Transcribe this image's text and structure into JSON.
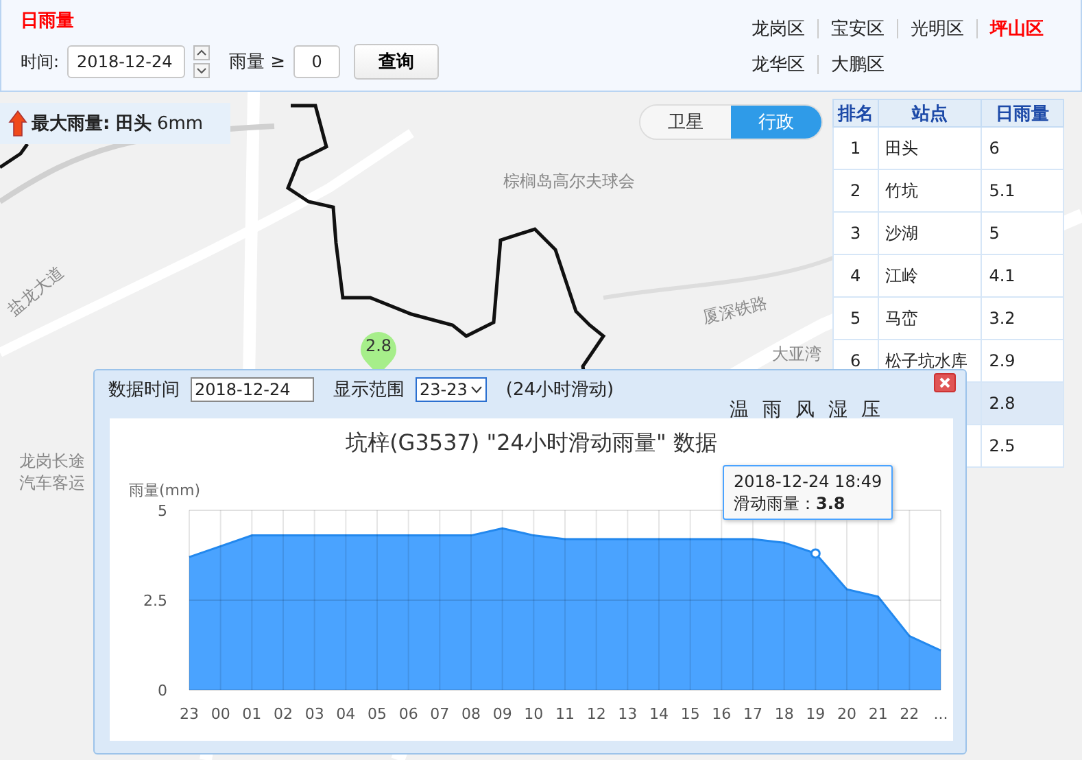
{
  "query_panel": {
    "title": "日雨量",
    "time_label": "时间:",
    "date": "2018-12-24",
    "rain_label": "雨量 ≥",
    "min_rain": "0",
    "query_button": "查询"
  },
  "district_rows": [
    {
      "items": [
        {
          "label": "龙岗区",
          "selected": false
        },
        {
          "label": "宝安区",
          "selected": false
        },
        {
          "label": "光明区",
          "selected": false
        },
        {
          "label": "坪山区",
          "selected": true
        }
      ]
    },
    {
      "items": [
        {
          "label": "龙华区",
          "selected": false
        },
        {
          "label": "大鹏区",
          "selected": false
        }
      ]
    }
  ],
  "map": {
    "max_rain": {
      "label": "最大雨量:",
      "station": "田头",
      "value": "6mm"
    },
    "layer_tabs": [
      {
        "label": "卫星",
        "selected": false
      },
      {
        "label": "行政",
        "selected": true
      }
    ],
    "labels": [
      {
        "text": "棕榈岛高尔夫球会",
        "kind": "place"
      },
      {
        "text": "盐龙大道",
        "kind": "road"
      },
      {
        "text": "厦深铁路",
        "kind": "rail"
      },
      {
        "text": "大亚湾",
        "kind": "place"
      },
      {
        "text": "龙岗长途",
        "kind": "place"
      },
      {
        "text": "汽车客运",
        "kind": "place"
      }
    ],
    "marker": "2.8"
  },
  "ranking_table": {
    "columns": [
      "排名",
      "站点",
      "日雨量"
    ],
    "rows": [
      {
        "rank": "1",
        "station": "田头",
        "value": "6",
        "selected": false
      },
      {
        "rank": "2",
        "station": "竹坑",
        "value": "5.1",
        "selected": false
      },
      {
        "rank": "3",
        "station": "沙湖",
        "value": "5",
        "selected": false
      },
      {
        "rank": "4",
        "station": "江岭",
        "value": "4.1",
        "selected": false
      },
      {
        "rank": "5",
        "station": "马峦",
        "value": "3.2",
        "selected": false
      },
      {
        "rank": "6",
        "station": "松子坑水库",
        "value": "2.9",
        "selected": false
      },
      {
        "value": "2.8",
        "selected": true
      },
      {
        "value": "2.5",
        "selected": false
      }
    ]
  },
  "popup": {
    "date_label": "数据时间",
    "date": "2018-12-24",
    "range_label": "显示范围",
    "range": "23-23",
    "mode": "(24小时滑动)",
    "element_tabs": [
      "温",
      "雨",
      "风",
      "湿",
      "压"
    ],
    "tooltip": {
      "time": "2018-12-24 18:49",
      "text": "滑动雨量：**3.8**"
    },
    "chart_data": {
      "type": "area",
      "title": "坑梓(G3537) \"24小时滑动雨量\" 数据",
      "ylabel": "雨量(mm)",
      "categories": [
        "23",
        "00",
        "01",
        "02",
        "03",
        "04",
        "05",
        "06",
        "07",
        "08",
        "09",
        "10",
        "11",
        "12",
        "13",
        "14",
        "15",
        "16",
        "17",
        "18",
        "19",
        "20",
        "21",
        "22",
        "..."
      ],
      "grid": true,
      "series": [
        {
          "color": "#4aa3ff",
          "values": [
            3.7,
            4.0,
            4.3,
            4.3,
            4.3,
            4.3,
            4.3,
            4.3,
            4.3,
            4.3,
            4.5,
            4.3,
            4.2,
            4.2,
            4.2,
            4.2,
            4.2,
            4.2,
            4.2,
            4.1,
            3.8,
            2.8,
            2.6,
            1.5,
            1.1
          ]
        }
      ],
      "ylim": [
        0,
        5
      ],
      "yticks": [
        0,
        2.5,
        5
      ]
    }
  }
}
